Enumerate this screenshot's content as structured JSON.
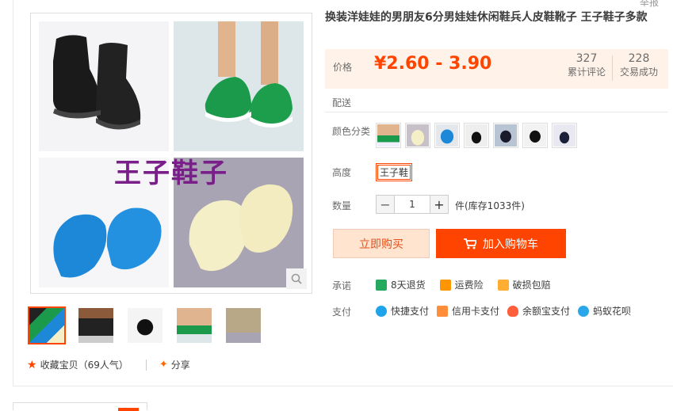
{
  "header": {
    "corner_text": "举报"
  },
  "product": {
    "title": "换装洋娃娃的男朋友6分男娃娃休闲鞋兵人皮鞋靴子 王子鞋子多款",
    "watermark": "王子鞋子",
    "price_label": "价格",
    "price": "¥2.60 - 3.90",
    "reviews_count": "327",
    "reviews_label": "累计评论",
    "sales_count": "228",
    "sales_label": "交易成功",
    "delivery_label": "配送",
    "color_label": "颜色分类",
    "color_options": [
      "green-sneaker",
      "cream-loafer",
      "blue-sneaker",
      "black-shoe",
      "black-boot",
      "black-boot-2",
      "navy-shoe"
    ],
    "height_label": "高度",
    "height_option": "王子鞋",
    "quantity_label": "数量",
    "quantity_value": "1",
    "stock_text": "件(库存1033件)",
    "buy_now": "立即购买",
    "add_cart": "加入购物车",
    "promise_label": "承诺",
    "promises": [
      "8天退货",
      "运费险",
      "破损包赔"
    ],
    "pay_label": "支付",
    "payments": [
      "快捷支付",
      "信用卡支付",
      "余额宝支付",
      "蚂蚁花呗"
    ]
  },
  "gallery": {
    "thumbnails": [
      "shoes-collage",
      "doll-boy",
      "black-shoes",
      "green-shoes",
      "khaki-legs"
    ]
  },
  "social": {
    "favorite": "收藏宝贝（69人气）",
    "share": "分享"
  },
  "colors": {
    "accent": "#ff4400",
    "price_bg": "#fff2e8",
    "buynow_bg": "#ffe4d0"
  }
}
